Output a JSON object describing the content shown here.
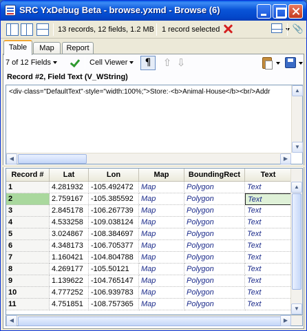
{
  "window": {
    "title": "SRC YxDebug Beta - browse.yxmd - Browse (6)"
  },
  "toolbar": {
    "summary": "13 records, 12 fields, 1.2 MB",
    "selection": "1 record selected"
  },
  "tabs": [
    {
      "label": "Table",
      "active": true
    },
    {
      "label": "Map",
      "active": false
    },
    {
      "label": "Report",
      "active": false
    }
  ],
  "viewer": {
    "field_selector": "7 of 12 Fields",
    "mode_selector": "Cell Viewer",
    "pilcrow": "¶",
    "up_arrow": "⇧",
    "down_arrow": "⇩",
    "record_title": "Record #2, Field Text (V_WString)",
    "cell_text": "<div·class=\"DefaultText\"·style=\"width:100%;\">Store:·<b>Animal·House</b><br/>Addr"
  },
  "grid": {
    "columns": [
      "Record #",
      "Lat",
      "Lon",
      "Map",
      "BoundingRect",
      "Text"
    ],
    "selected_record": "2",
    "rows": [
      {
        "rec": "1",
        "lat": "4.281932",
        "lon": "-105.492472",
        "map": "Map",
        "rect": "Polygon",
        "text": "Text"
      },
      {
        "rec": "2",
        "lat": "2.759167",
        "lon": "-105.385592",
        "map": "Map",
        "rect": "Polygon",
        "text": "Text"
      },
      {
        "rec": "3",
        "lat": "2.845178",
        "lon": "-106.267739",
        "map": "Map",
        "rect": "Polygon",
        "text": "Text"
      },
      {
        "rec": "4",
        "lat": "4.533258",
        "lon": "-109.038124",
        "map": "Map",
        "rect": "Polygon",
        "text": "Text"
      },
      {
        "rec": "5",
        "lat": "3.024867",
        "lon": "-108.384697",
        "map": "Map",
        "rect": "Polygon",
        "text": "Text"
      },
      {
        "rec": "6",
        "lat": "4.348173",
        "lon": "-106.705377",
        "map": "Map",
        "rect": "Polygon",
        "text": "Text"
      },
      {
        "rec": "7",
        "lat": "1.160421",
        "lon": "-104.804788",
        "map": "Map",
        "rect": "Polygon",
        "text": "Text"
      },
      {
        "rec": "8",
        "lat": "4.269177",
        "lon": "-105.50121",
        "map": "Map",
        "rect": "Polygon",
        "text": "Text"
      },
      {
        "rec": "9",
        "lat": "1.139622",
        "lon": "-104.765147",
        "map": "Map",
        "rect": "Polygon",
        "text": "Text"
      },
      {
        "rec": "10",
        "lat": "4.777252",
        "lon": "-106.939783",
        "map": "Map",
        "rect": "Polygon",
        "text": "Text"
      },
      {
        "rec": "11",
        "lat": "4.751851",
        "lon": "-108.757365",
        "map": "Map",
        "rect": "Polygon",
        "text": "Text"
      }
    ]
  },
  "colors": {
    "selected_row_header": "#a9d89d",
    "title_bar": "#0a55d8",
    "link_text": "#1a2a8a"
  }
}
